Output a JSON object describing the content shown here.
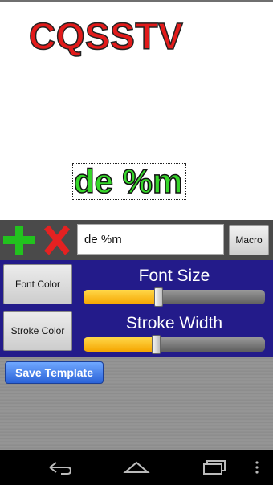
{
  "canvas": {
    "title_text": "CQSSTV",
    "overlay_text": "de %m",
    "title_color": "#e21b1b",
    "overlay_color": "#36d62a"
  },
  "toolbar": {
    "add_icon": "plus-icon",
    "remove_icon": "x-icon",
    "text_value": "de %m",
    "macro_label": "Macro"
  },
  "controls": {
    "font_color_label": "Font Color",
    "font_size_label": "Font Size",
    "font_size_level": 0.41,
    "stroke_color_label": "Stroke Color",
    "stroke_width_label": "Stroke Width",
    "stroke_width_level": 0.4,
    "panel_color": "#231b8a"
  },
  "save_template_label": "Save Template",
  "navbar": {
    "back_icon": "back-icon",
    "home_icon": "home-icon",
    "recents_icon": "recents-icon",
    "menu_icon": "overflow-menu-icon"
  }
}
